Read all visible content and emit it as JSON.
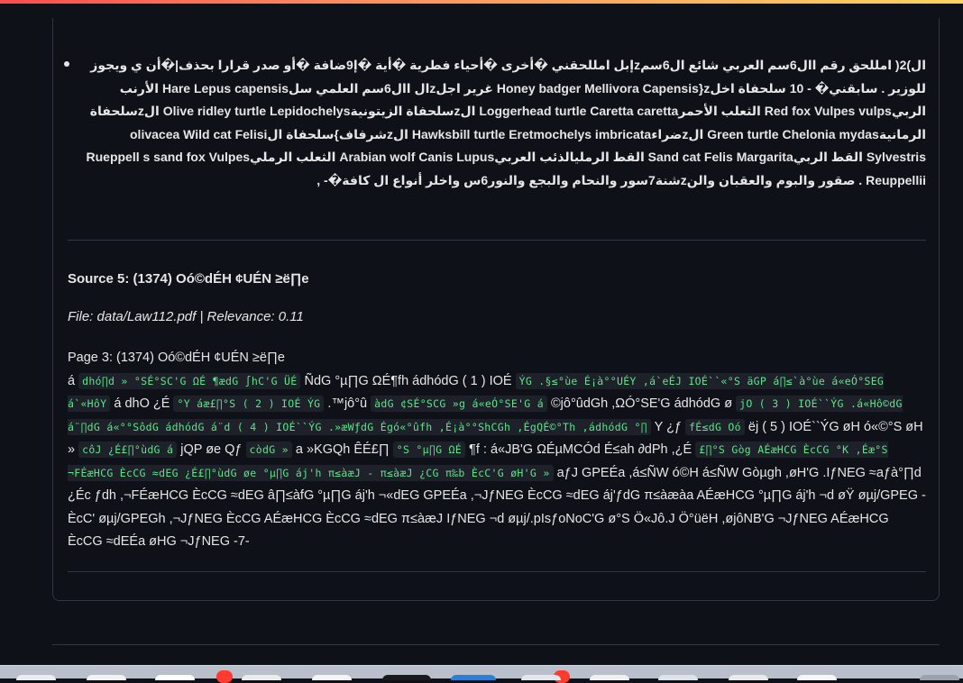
{
  "result": {
    "list_item_text": "ال)2( امللحق رقم اال6سم العربي شائع ال6سمzإبل امللحقني �أخرى �أحياء فطرية �أية �إ9ضافة �أو صدر قرارا بحذف|�أن ي ويجوز للوزير . سابقني� - 10 سلحفاة اخلz{Honey badger Mellivora Capensis غرير اجلzال اال6سم العلمي سلHare Lepus capensis الأرنب الربيRed fox Vulpes vulps الثعلب الأحمرLoggerhead turtle Caretta caretta الzسلحفاة الزيتونيةOlive ridley turtle Lepidochelys الzسلحفاة الرمانيةGreen turtle Chelonia mydas الzضراءHawksbill turtle Eretmochelys imbricata الzشرفاف}سلحفاة الolivacea Wild cat Felisi Sylvestris القط الربيSand cat Felis Margarita القط الرمليالذئب العربيArabian wolf Canis Lupus الثعلب الرمليRueppell s sand fox Vulpes Reuppellii . صقور والبوم والعقبان والنzشنة7سور والنحام والبجع والنور6س واخلر أنواع ال كافة�- ,",
    "source_title": "Source 5: (1374) Oó©dÉH ¢UÉN ≥ë∏e",
    "file_line": "File: data/Law112.pdf | Relevance: 0.11",
    "page_heading": "Page 3: (1374) Oó©dÉH ¢UÉN ≥ë∏e",
    "body": {
      "t1": "á ",
      "c1": "dhó∏d » °SÉ°SC'G ΩÉ ¶ædG ∫hC'G ÜÉ",
      "t2": " ÑdG °µ∏G ΩÉ¶fh ádhódG ( 1 ) IOÉ ",
      "c2": "ÝG .§≤°ùe É¡à°°UÉY ,á`eÉJ IOÉ``«°S äGP á∏≤`à°ùe á«eÓ°SEG á`«HôY",
      "t3": " á dhO ¿É ",
      "c3": "°Y áæ£∏°S ( 2 ) IOÉ ÝG",
      "t4": " .™jô°û ",
      "c4": "àdG ¢SÉ°SCG »g á«eÓ°SE'G á",
      "t5": " ©jô°ûdGh ,ΩÓ°SE'G ádhódG ø ",
      "c5": "jO ( 3 ) IOÉ``ÝG .á«Hô©dG á¨∏dG á«°°SôdG ádhódG á¨d ( 4 ) IOÉ``ÝG .»æWƒdG Égó«°ûfh ,É¡à°°ShCGh ,ÉgQÉ©°Th ,ádhódG °∏",
      "t6": " Y ¿ƒ ",
      "c6": "fÉ≤dG Oó",
      "t7": " ëj ( 5 ) IOÉ``ÝG øH ó«©°S øH » ",
      "c7": "côJ ¿É£∏°ùdG á",
      "t8": " jQP øe Qƒ ",
      "c8": "còdG »",
      "t9": " a »KGQh ÊÉ£∏ ",
      "c9": "°S °µ∏G ΩÉ",
      "t10": " ¶f : á«JB'G ΩÉµMCÓd É≤ah ∂dPh ,¿É ",
      "c10": "£∏°S  Gòg AÉæHCG ÈcCG °K ,Éæ°S ¬FÉæHCG ÈcCG ≈dEG ¿É£∏°ùdG øe °µ∏G áj'h π≤àæJ -  π≤àæJ ¿CG π‰b ÈcC'G øH'G »",
      "t11": " aƒJ GPEÉa ,á≤ÑW ó©H á≤ÑW Gòµgh ,øH'G .IƒNEG ≈aƒà°∏d ¿Éc ƒdh ,¬FÉæHCG ÈcCG ≈dEG â∏≤àfG °µ∏G áj'h ¬«dEG GPEÉa ,¬JƒNEG ÈcCG ≈dEG áj'ƒdG π≤àæàa AÉæHCG °µ∏G áj'h ¬d øŸ øµj/GPEG - ÈcC' øµj/GPEGh ,¬JƒNEG ÈcCG AÉæHCG ÈcCG ≈dEG π≤àæJ IƒNEG ¬d øµj/.pIsƒoNoC'G ø°S Ö«Jô.J Ö°üëH ,øjôNB'G ¬JƒNEG AÉæHCG ÈcCG ≈dEÉa øHG ¬JƒNEG -7-"
    }
  },
  "colors": {
    "background": "#0e1117",
    "text": "#e6e6e6",
    "code_text": "#5ce488",
    "code_bg": "#1e2129",
    "border": "#33363f"
  }
}
